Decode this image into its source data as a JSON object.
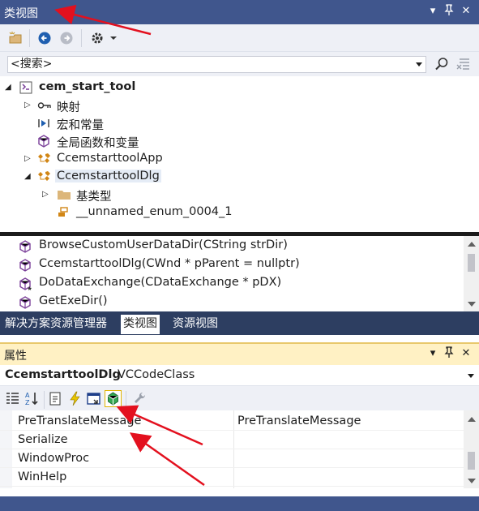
{
  "class_view": {
    "title": "类视图",
    "search_placeholder": "<搜索>",
    "tree": [
      {
        "label": "cem_start_tool",
        "bold": true
      },
      {
        "label": "映射"
      },
      {
        "label": "宏和常量"
      },
      {
        "label": "全局函数和变量"
      },
      {
        "label": "CcemstarttoolApp"
      },
      {
        "label": "CcemstarttoolDlg",
        "selected": true
      },
      {
        "label": "基类型"
      },
      {
        "label": "__unnamed_enum_0004_1"
      }
    ],
    "members": [
      "BrowseCustomUserDataDir(CString strDir)",
      "CcemstarttoolDlg(CWnd * pParent = nullptr)",
      "DoDataExchange(CDataExchange * pDX)",
      "GetExeDir()"
    ]
  },
  "tabs": [
    "解决方案资源管理器",
    "类视图",
    "资源视图"
  ],
  "properties": {
    "title": "属性",
    "object_name": "CcemstarttoolDlg",
    "object_type": "VCCodeClass",
    "rows": [
      {
        "name": "PreTranslateMessage",
        "value": "PreTranslateMessage"
      },
      {
        "name": "Serialize",
        "value": ""
      },
      {
        "name": "WindowProc",
        "value": ""
      },
      {
        "name": "WinHelp",
        "value": ""
      }
    ]
  },
  "colors": {
    "title_bar": "#40568d",
    "tab_bar": "#2d3e61",
    "properties_title": "#fff1c4",
    "annotation_arrow": "#e3101e"
  }
}
